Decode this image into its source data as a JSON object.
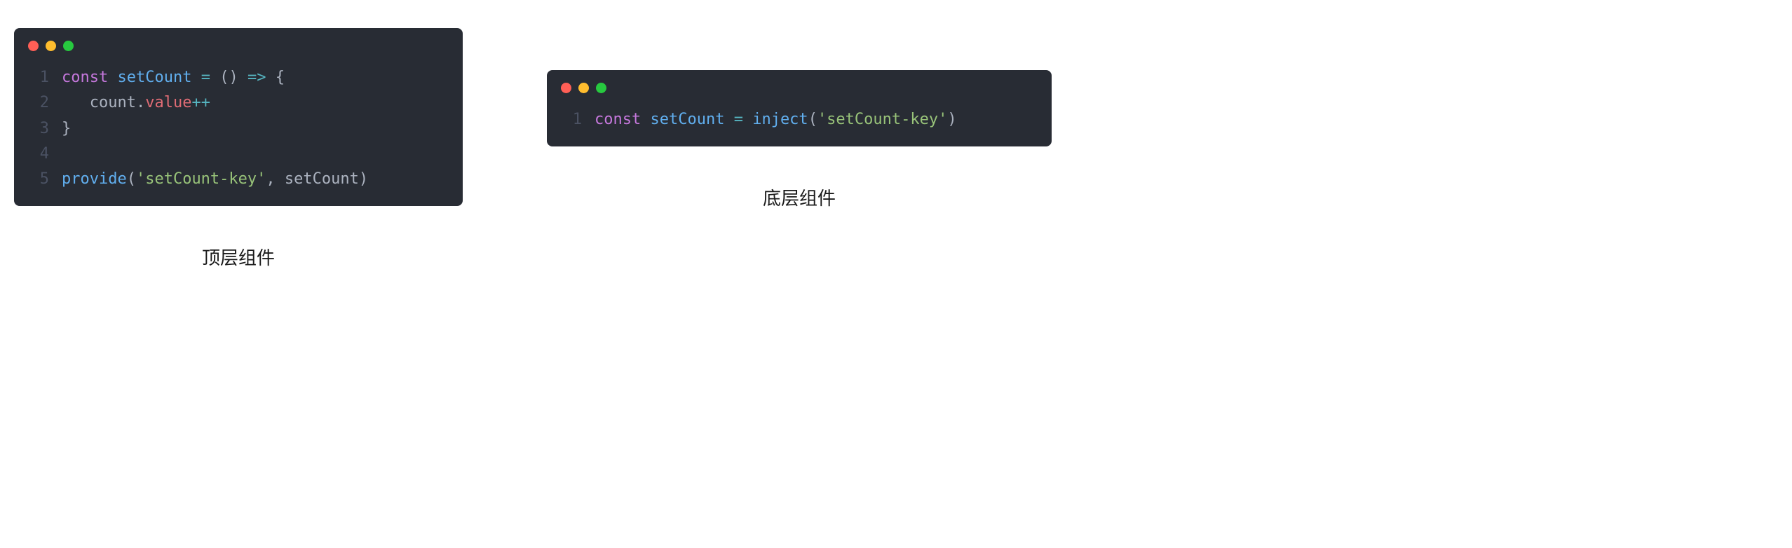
{
  "left": {
    "caption": "顶层组件",
    "lines": [
      {
        "n": "1",
        "tokens": [
          {
            "cls": "tok-keyword",
            "t": "const"
          },
          {
            "cls": "tok-plain",
            "t": " "
          },
          {
            "cls": "tok-def",
            "t": "setCount"
          },
          {
            "cls": "tok-plain",
            "t": " "
          },
          {
            "cls": "tok-op",
            "t": "="
          },
          {
            "cls": "tok-plain",
            "t": " "
          },
          {
            "cls": "tok-punct",
            "t": "()"
          },
          {
            "cls": "tok-plain",
            "t": " "
          },
          {
            "cls": "tok-op",
            "t": "=>"
          },
          {
            "cls": "tok-plain",
            "t": " "
          },
          {
            "cls": "tok-punct",
            "t": "{"
          }
        ]
      },
      {
        "n": "2",
        "tokens": [
          {
            "cls": "tok-plain",
            "t": "   "
          },
          {
            "cls": "tok-ident",
            "t": "count"
          },
          {
            "cls": "tok-punct",
            "t": "."
          },
          {
            "cls": "tok-prop",
            "t": "value"
          },
          {
            "cls": "tok-op",
            "t": "++"
          }
        ]
      },
      {
        "n": "3",
        "tokens": [
          {
            "cls": "tok-punct",
            "t": "}"
          }
        ]
      },
      {
        "n": "4",
        "tokens": []
      },
      {
        "n": "5",
        "tokens": [
          {
            "cls": "tok-func",
            "t": "provide"
          },
          {
            "cls": "tok-punct",
            "t": "("
          },
          {
            "cls": "tok-string",
            "t": "'setCount-key'"
          },
          {
            "cls": "tok-punct",
            "t": ", "
          },
          {
            "cls": "tok-ident",
            "t": "setCount"
          },
          {
            "cls": "tok-punct",
            "t": ")"
          }
        ]
      }
    ]
  },
  "right": {
    "caption": "底层组件",
    "lines": [
      {
        "n": "1",
        "tokens": [
          {
            "cls": "tok-keyword",
            "t": "const"
          },
          {
            "cls": "tok-plain",
            "t": " "
          },
          {
            "cls": "tok-def",
            "t": "setCount"
          },
          {
            "cls": "tok-plain",
            "t": " "
          },
          {
            "cls": "tok-op",
            "t": "="
          },
          {
            "cls": "tok-plain",
            "t": " "
          },
          {
            "cls": "tok-func",
            "t": "inject"
          },
          {
            "cls": "tok-punct",
            "t": "("
          },
          {
            "cls": "tok-string",
            "t": "'setCount-key'"
          },
          {
            "cls": "tok-punct",
            "t": ")"
          }
        ]
      }
    ]
  }
}
